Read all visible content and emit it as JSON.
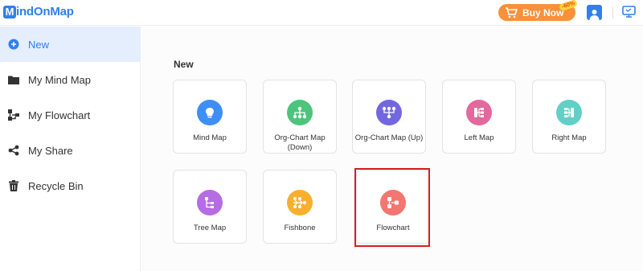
{
  "header": {
    "logo_letter": "M",
    "logo_text": "indOnMap",
    "buy_label": "Buy Now",
    "discount": "-60%",
    "icons": [
      "cart-icon",
      "user-icon",
      "monitor-icon"
    ]
  },
  "sidebar": {
    "items": [
      {
        "label": "New",
        "icon": "plus-circle-icon",
        "active": true
      },
      {
        "label": "My Mind Map",
        "icon": "folder-icon",
        "active": false
      },
      {
        "label": "My Flowchart",
        "icon": "flowchart-icon",
        "active": false
      },
      {
        "label": "My Share",
        "icon": "share-icon",
        "active": false
      },
      {
        "label": "Recycle Bin",
        "icon": "trash-icon",
        "active": false
      }
    ]
  },
  "main": {
    "section_title": "New",
    "templates": [
      {
        "label": "Mind Map",
        "icon": "brain-icon",
        "color": "#3d8ff5"
      },
      {
        "label": "Org-Chart Map (Down)",
        "icon": "org-chart-down-icon",
        "color": "#4cc47c"
      },
      {
        "label": "Org-Chart Map (Up)",
        "icon": "org-chart-up-icon",
        "color": "#7367e0"
      },
      {
        "label": "Left Map",
        "icon": "left-map-icon",
        "color": "#e3699c"
      },
      {
        "label": "Right Map",
        "icon": "right-map-icon",
        "color": "#63cfc7"
      },
      {
        "label": "Tree Map",
        "icon": "tree-map-icon",
        "color": "#b66de3"
      },
      {
        "label": "Fishbone",
        "icon": "fishbone-icon",
        "color": "#f6b02e"
      },
      {
        "label": "Flowchart",
        "icon": "flowchart-template-icon",
        "color": "#f47670"
      }
    ],
    "highlighted": "Flowchart"
  }
}
